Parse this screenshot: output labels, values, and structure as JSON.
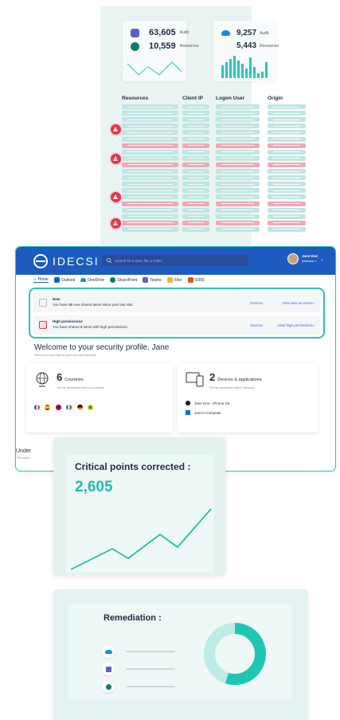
{
  "audit_panel": {
    "card_left": {
      "rows": [
        {
          "value": "63,605",
          "label": "Audit",
          "icon": "teams-icon"
        },
        {
          "value": "10,559",
          "label": "Resources",
          "icon": "sharepoint-icon"
        }
      ]
    },
    "card_right": {
      "rows": [
        {
          "value": "9,257",
          "label": "Audit",
          "icon": "onedrive-icon"
        },
        {
          "value": "5,443",
          "label": "Resources"
        }
      ]
    },
    "columns": [
      "Resources",
      "Client IP",
      "Logon User",
      "Origin"
    ],
    "colors": {
      "accent": "#20bfae",
      "alert": "#e8344e",
      "cell": "#bfe6e2",
      "cell_alert": "#f4a7b5"
    }
  },
  "app": {
    "logo_text": "IDECSI",
    "search_placeholder": "Search for a user, file or folder",
    "user_name": "Jane Doe",
    "user_instance": "Instance 1",
    "nav": [
      {
        "label": "Home",
        "icon": "home-icon"
      },
      {
        "label": "Outlook",
        "icon": "outlook-icon"
      },
      {
        "label": "OneDrive",
        "icon": "onedrive-icon"
      },
      {
        "label": "SharePoint",
        "icon": "sharepoint-icon"
      },
      {
        "label": "Teams",
        "icon": "teams-icon"
      },
      {
        "label": "Filer",
        "icon": "folder-icon"
      },
      {
        "label": "O365",
        "icon": "office-icon"
      }
    ],
    "notifications": [
      {
        "title": "New",
        "pre": "You have ",
        "count": "15",
        "post": " new shared items since your last visit.",
        "dismiss": "Dismiss",
        "link": "View new accesses ›",
        "icon": "new-items-icon"
      },
      {
        "title": "High permissions",
        "pre": "You have shared ",
        "count": "2",
        "post": " items with high permissions.",
        "dismiss": "Dismiss",
        "link": "View high permissions ›",
        "icon": "high-permission-icon"
      }
    ],
    "welcome_title": "Welcome to your security profile, Jane",
    "welcome_sub": "Here's an overview of your account security.",
    "countries": {
      "count": "6",
      "label": "Countries",
      "sub": "You've accessed from 6 countries."
    },
    "devices": {
      "count": "2",
      "label": "Devices & applications",
      "sub": "You've accessed with 2 devices.",
      "items": [
        "Jane Doe - iPhone XS",
        "Jane's Computer"
      ]
    },
    "under_title": "Under",
    "under_sub": "The data p"
  },
  "critical": {
    "title": "Critical points corrected :",
    "value": "2,605"
  },
  "remediation": {
    "title": "Remediation :",
    "donut_fraction": 0.55
  }
}
